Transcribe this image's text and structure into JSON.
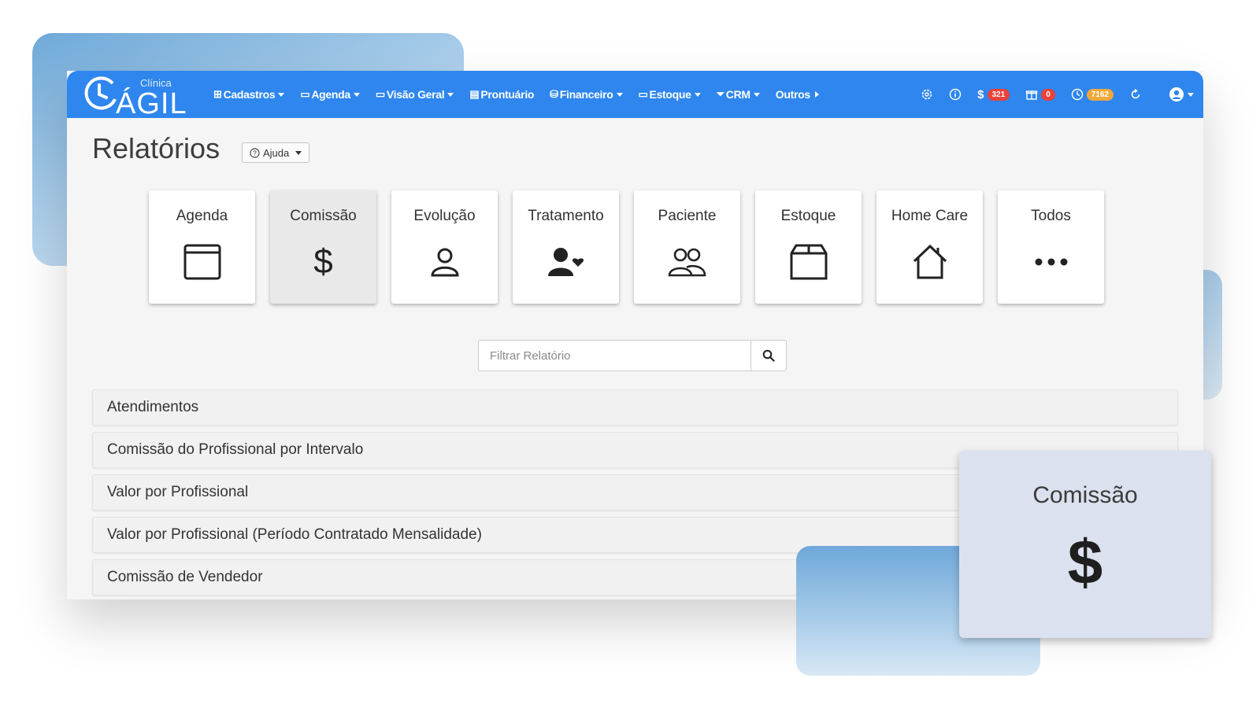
{
  "brand": {
    "small": "Clínica",
    "big": "ÁGIL"
  },
  "nav": [
    {
      "label": "Cadastros",
      "icon": "⊞"
    },
    {
      "label": "Agenda",
      "icon": "▭"
    },
    {
      "label": "Visão Geral",
      "icon": "▭"
    },
    {
      "label": "Prontuário",
      "icon": "▤"
    },
    {
      "label": "Financeiro",
      "icon": "⛁"
    },
    {
      "label": "Estoque",
      "icon": "▭"
    },
    {
      "label": "CRM",
      "icon": "⏷"
    },
    {
      "label": "Outros",
      "icon": ""
    }
  ],
  "tools": {
    "dollar": "$",
    "badge_finance": "321",
    "badge_gift": "0",
    "badge_clock": "7162"
  },
  "page": {
    "title": "Relatórios",
    "help_label": "Ajuda"
  },
  "cards": [
    {
      "label": "Agenda",
      "icon": "calendar-icon"
    },
    {
      "label": "Comissão",
      "icon": "dollar-icon"
    },
    {
      "label": "Evolução",
      "icon": "user-icon"
    },
    {
      "label": "Tratamento",
      "icon": "user-heart-icon"
    },
    {
      "label": "Paciente",
      "icon": "users-icon"
    },
    {
      "label": "Estoque",
      "icon": "box-icon"
    },
    {
      "label": "Home Care",
      "icon": "home-icon"
    },
    {
      "label": "Todos",
      "icon": "more-icon"
    }
  ],
  "search": {
    "placeholder": "Filtrar Relatório"
  },
  "reports": [
    "Atendimentos",
    "Comissão do Profissional por Intervalo",
    "Valor por Profissional",
    "Valor por Profissional (Período Contratado Mensalidade)",
    "Comissão de Vendedor"
  ],
  "zoom": {
    "label": "Comissão",
    "symbol": "$"
  },
  "colors": {
    "topbar": "#2e86ee",
    "badge_red": "#e8423b",
    "badge_orange": "#f1a83a"
  }
}
